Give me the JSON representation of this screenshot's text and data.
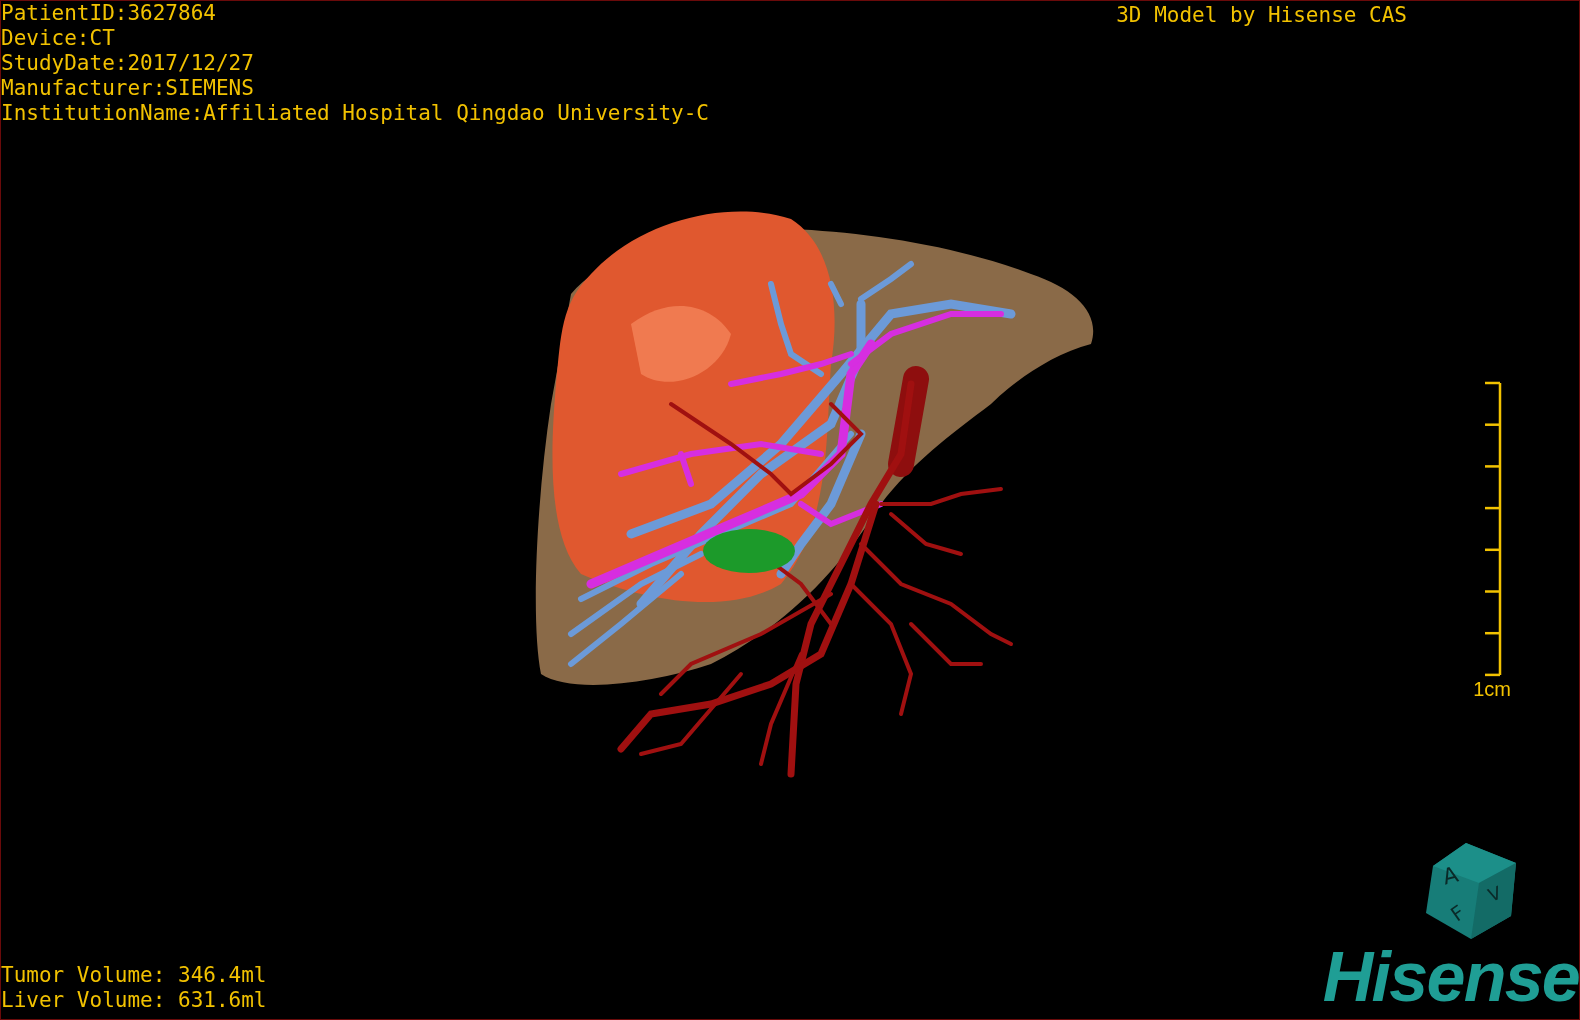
{
  "study_info": [
    "PatientID:3627864",
    "Device:CT",
    "StudyDate:2017/12/27",
    "Manufacturer:SIEMENS",
    "InstitutionName:Affiliated Hospital Qingdao University-C"
  ],
  "viewer_title": "3D Model by Hisense CAS",
  "scale_bar": {
    "label": "1cm"
  },
  "volumes": [
    "Tumor Volume: 346.4ml",
    "Liver Volume: 631.6ml"
  ],
  "orientation_cube": {
    "labels": [
      "A",
      "F",
      "V"
    ]
  },
  "logo": "Hisense"
}
